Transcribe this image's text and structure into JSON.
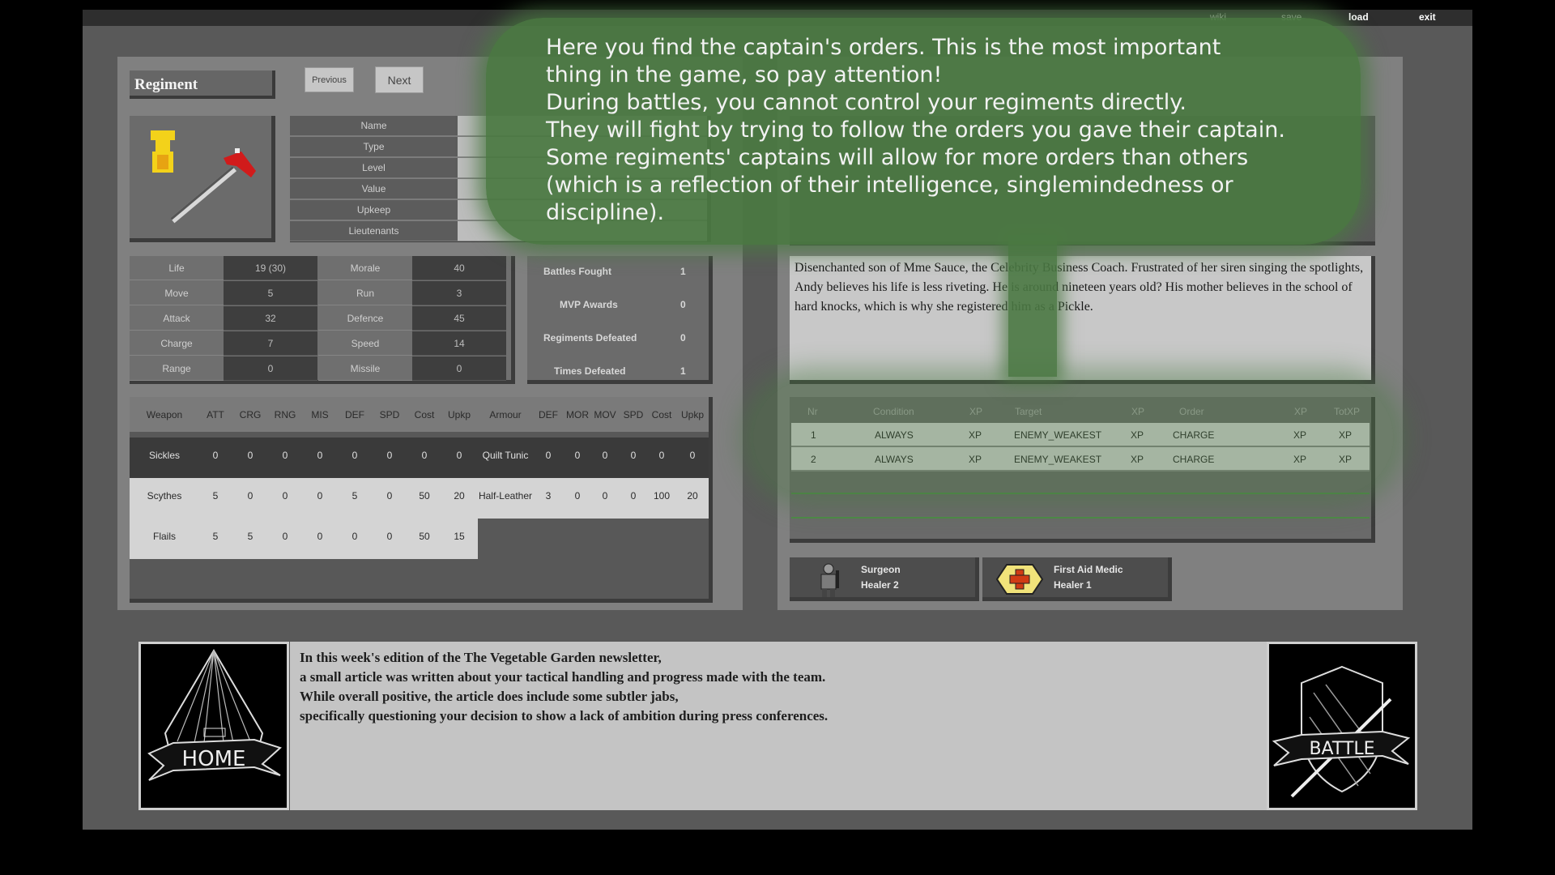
{
  "topnav": [
    "wiki",
    "save",
    "load",
    "exit"
  ],
  "regiment": {
    "title": "Regiment",
    "prev_label": "Previous",
    "next_label": "Next",
    "info_labels": [
      "Name",
      "Type",
      "Level",
      "Value",
      "Upkeep",
      "Lieutenants"
    ],
    "stats": [
      {
        "label": "Life",
        "value": "19 (30)",
        "label2": "Morale",
        "value2": "40"
      },
      {
        "label": "Move",
        "value": "5",
        "label2": "Run",
        "value2": "3"
      },
      {
        "label": "Attack",
        "value": "32",
        "label2": "Defence",
        "value2": "45"
      },
      {
        "label": "Charge",
        "value": "7",
        "label2": "Speed",
        "value2": "14"
      },
      {
        "label": "Range",
        "value": "0",
        "label2": "Missile",
        "value2": "0"
      }
    ],
    "battle_stats": [
      {
        "label": "Battles Fought",
        "value": "1"
      },
      {
        "label": "MVP Awards",
        "value": "0"
      },
      {
        "label": "Regiments Defeated",
        "value": "0"
      },
      {
        "label": "Times Defeated",
        "value": "1"
      }
    ]
  },
  "weapons": {
    "headers": [
      "Weapon",
      "ATT",
      "CRG",
      "RNG",
      "MIS",
      "DEF",
      "SPD",
      "Cost",
      "Upkp",
      "Armour",
      "DEF",
      "MOR",
      "MOV",
      "SPD",
      "Cost",
      "Upkp"
    ],
    "rows": [
      [
        "Sickles",
        "0",
        "0",
        "0",
        "0",
        "0",
        "0",
        "0",
        "0",
        "Quilt Tunic",
        "0",
        "0",
        "0",
        "0",
        "0",
        "0"
      ],
      [
        "Scythes",
        "5",
        "0",
        "0",
        "0",
        "5",
        "0",
        "50",
        "20",
        "Half-Leather",
        "3",
        "0",
        "0",
        "0",
        "100",
        "20"
      ],
      [
        "Flails",
        "5",
        "5",
        "0",
        "0",
        "0",
        "0",
        "50",
        "15"
      ]
    ]
  },
  "description": "Disenchanted son of Mme Sauce, the Celebrity Business Coach. Frustrated of her siren singing the spotlights, Andy believes his life is less riveting. He is around nineteen years old? His mother believes in the school of hard knocks, which is why she registered him as a Pickle.",
  "orders": {
    "headers": [
      "Nr",
      "Condition",
      "XP",
      "Target",
      "XP",
      "Order",
      "XP",
      "TotXP"
    ],
    "rows": [
      [
        "1",
        "ALWAYS",
        "XP",
        "ENEMY_WEAKEST",
        "XP",
        "CHARGE",
        "XP",
        "XP"
      ],
      [
        "2",
        "ALWAYS",
        "XP",
        "ENEMY_WEAKEST",
        "XP",
        "CHARGE",
        "XP",
        "XP"
      ]
    ]
  },
  "lieutenants": [
    {
      "name": "Surgeon",
      "role": "Healer 2",
      "icon": "surgeon-figure-icon"
    },
    {
      "name": "First Aid Medic",
      "role": "Healer 1",
      "icon": "red-cross-icon"
    }
  ],
  "news": [
    "In this week's edition of the The Vegetable Garden newsletter,",
    "a small article was written about your tactical handling and progress made with the team.",
    "While overall positive, the article does include some subtler jabs,",
    "specifically questioning your decision to show a lack of ambition during press conferences."
  ],
  "home_label": "HOME",
  "battle_label": "BATTLE",
  "tooltip": [
    "Here you find the captain's orders. This is the most important",
    "thing in the game, so pay attention!",
    "During battles, you cannot control your regiments directly.",
    "They will fight by trying to follow the orders you gave their captain.",
    "Some regiments' captains will allow for more orders than others",
    "(which is a reflection of their intelligence, singlemindedness or",
    "discipline)."
  ],
  "colors": {
    "tooltip_green": "#4a7842",
    "frame": "#595959",
    "panel": "#808080"
  }
}
